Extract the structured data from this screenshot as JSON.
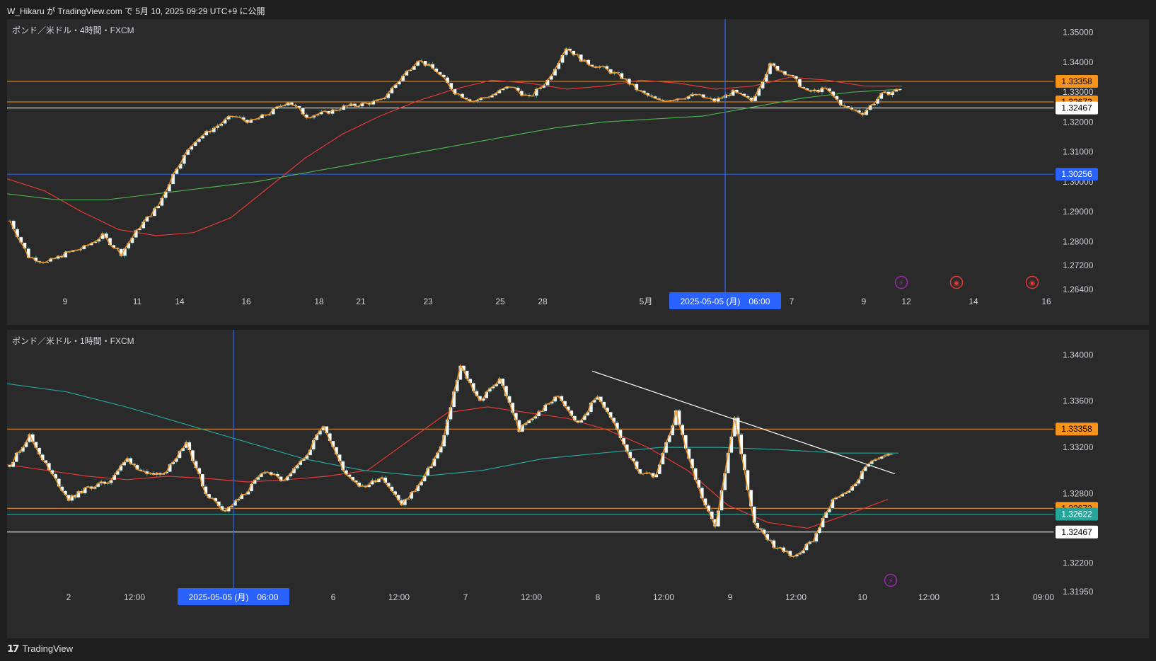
{
  "header": {
    "published": "W_Hikaru が TradingView.com で 5月 10, 2025 09:29 UTC+9 に公開"
  },
  "footer": {
    "brand": "TradingView"
  },
  "colors": {
    "background": "#2a2a2a",
    "up": "#e8f4f6",
    "down": "#ffffff",
    "wick": "#26a69a",
    "orange": "#f7931a",
    "hline_blue": "#2962ff",
    "ma_red": "#e53935",
    "ma_green": "#4caf50",
    "ma_teal": "#26a69a"
  },
  "chart_data": [
    {
      "type": "candlestick",
      "title": "ポンド／米ドル・4時間・FXCM",
      "ylim": [
        1.264,
        1.353
      ],
      "y_ticks": [
        "1.35000",
        "1.34000",
        "1.33000",
        "1.32000",
        "1.31000",
        "1.30000",
        "1.29000",
        "1.28000",
        "1.27200",
        "1.26400"
      ],
      "x_ticks": [
        "9",
        "11",
        "14",
        "16",
        "18",
        "21",
        "23",
        "25",
        "28",
        "5月",
        "7",
        "9",
        "12",
        "14",
        "16"
      ],
      "crosshair_label": "2025-05-05 (月)　06:00",
      "price_labels": [
        {
          "value": 1.33358,
          "text": "1.33358",
          "color": "#f7931a"
        },
        {
          "value": 1.32672,
          "text": "1.32672",
          "color": "#f7931a"
        },
        {
          "value": 1.32467,
          "text": "1.32467",
          "color": "#ffffff"
        },
        {
          "value": 1.30256,
          "text": "1.30256",
          "color": "#2962ff"
        }
      ],
      "close_path": [
        1.287,
        1.275,
        1.273,
        1.276,
        1.278,
        1.282,
        1.276,
        1.285,
        1.292,
        1.305,
        1.314,
        1.318,
        1.322,
        1.32,
        1.323,
        1.327,
        1.322,
        1.323,
        1.325,
        1.326,
        1.327,
        1.334,
        1.341,
        1.337,
        1.33,
        1.327,
        1.329,
        1.332,
        1.328,
        1.334,
        1.345,
        1.34,
        1.338,
        1.335,
        1.33,
        1.327,
        1.328,
        1.329,
        1.327,
        1.33,
        1.327,
        1.339,
        1.336,
        1.33,
        1.331,
        1.325,
        1.323,
        1.329,
        1.331
      ],
      "series": [
        {
          "name": "MA-red",
          "values": [
            1.301,
            1.297,
            1.29,
            1.284,
            1.282,
            1.283,
            1.288,
            1.298,
            1.308,
            1.316,
            1.322,
            1.327,
            1.331,
            1.334,
            1.333,
            1.331,
            1.332,
            1.334,
            1.333,
            1.331,
            1.332,
            1.335,
            1.334,
            1.332,
            1.332
          ]
        },
        {
          "name": "MA-green",
          "values": [
            1.296,
            1.294,
            1.294,
            1.296,
            1.298,
            1.3,
            1.303,
            1.306,
            1.309,
            1.312,
            1.315,
            1.318,
            1.32,
            1.321,
            1.322,
            1.325,
            1.328,
            1.33,
            1.331
          ]
        }
      ]
    },
    {
      "type": "candlestick",
      "title": "ポンド／米ドル・1時間・FXCM",
      "ylim": [
        1.3189,
        1.3418
      ],
      "y_ticks": [
        "1.34000",
        "1.33600",
        "1.33200",
        "1.32800",
        "1.32200",
        "1.31950"
      ],
      "x_ticks": [
        "2",
        "12:00",
        "6",
        "12:00",
        "7",
        "12:00",
        "8",
        "12:00",
        "9",
        "12:00",
        "10",
        "12:00",
        "13",
        "09:00"
      ],
      "crosshair_label": "2025-05-05 (月)　06:00",
      "price_labels": [
        {
          "value": 1.33358,
          "text": "1.33358",
          "color": "#f7931a"
        },
        {
          "value": 1.32672,
          "text": "1.32672",
          "color": "#f7931a"
        },
        {
          "value": 1.32622,
          "text": "1.32622",
          "color": "#26a69a"
        },
        {
          "value": 1.32467,
          "text": "1.32467",
          "color": "#ffffff"
        }
      ],
      "close_path": [
        1.3305,
        1.333,
        1.33,
        1.3275,
        1.3285,
        1.329,
        1.331,
        1.3295,
        1.33,
        1.3325,
        1.328,
        1.3265,
        1.328,
        1.33,
        1.329,
        1.331,
        1.334,
        1.33,
        1.3285,
        1.3295,
        1.327,
        1.329,
        1.332,
        1.339,
        1.336,
        1.338,
        1.3335,
        1.335,
        1.3365,
        1.334,
        1.3365,
        1.3335,
        1.33,
        1.3295,
        1.335,
        1.329,
        1.325,
        1.3345,
        1.3255,
        1.3235,
        1.3225,
        1.324,
        1.3275,
        1.3285,
        1.331,
        1.3315
      ],
      "series": [
        {
          "name": "MA-red",
          "values": [
            1.3305,
            1.33,
            1.3295,
            1.3292,
            1.3295,
            1.3293,
            1.329,
            1.3292,
            1.3295,
            1.33,
            1.3325,
            1.335,
            1.3355,
            1.335,
            1.3345,
            1.3335,
            1.332,
            1.33,
            1.327,
            1.3255,
            1.325,
            1.3262,
            1.3275
          ]
        },
        {
          "name": "MA-teal",
          "values": [
            1.3375,
            1.3368,
            1.3355,
            1.334,
            1.3325,
            1.331,
            1.33,
            1.3295,
            1.33,
            1.331,
            1.3315,
            1.332,
            1.332,
            1.3318,
            1.3315,
            1.3315
          ]
        }
      ],
      "trendline": {
        "from": [
          1.3386,
          "8"
        ],
        "to": [
          1.3297,
          "10"
        ]
      }
    }
  ]
}
